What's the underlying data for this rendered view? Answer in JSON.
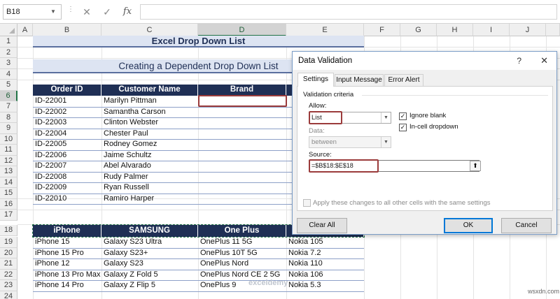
{
  "formula_bar": {
    "name_box": "B18",
    "cancel": "✕",
    "enter": "✓",
    "fx": "fx",
    "value": ""
  },
  "columns": [
    "A",
    "B",
    "C",
    "D",
    "E",
    "F",
    "G",
    "H",
    "I",
    "J"
  ],
  "rows": [
    "1",
    "2",
    "3",
    "4",
    "5",
    "6",
    "7",
    "8",
    "9",
    "10",
    "11",
    "12",
    "13",
    "14",
    "15",
    "16",
    "17",
    "18",
    "19",
    "20",
    "21",
    "22",
    "23",
    "24"
  ],
  "sheet": {
    "title": "Excel Drop Down List",
    "subtitle": "Creating a Dependent Drop Down List",
    "table1": {
      "headers": [
        "Order ID",
        "Customer Name",
        "Brand",
        ""
      ],
      "rows": [
        [
          "ID-22001",
          "Marilyn Pittman"
        ],
        [
          "ID-22002",
          "Samantha Carson"
        ],
        [
          "ID-22003",
          "Clinton Webster"
        ],
        [
          "ID-22004",
          "Chester Paul"
        ],
        [
          "ID-22005",
          "Rodney Gomez"
        ],
        [
          "ID-22006",
          "Jaime Schultz"
        ],
        [
          "ID-22007",
          "Abel Alvarado"
        ],
        [
          "ID-22008",
          "Rudy Palmer"
        ],
        [
          "ID-22009",
          "Ryan Russell"
        ],
        [
          "ID-22010",
          "Ramiro Harper"
        ]
      ]
    },
    "table2": {
      "headers": [
        "iPhone",
        "SAMSUNG",
        "One Plus",
        ""
      ],
      "rows": [
        [
          "iPhone 15",
          "Galaxy S23 Ultra",
          "OnePlus 11 5G",
          "Nokia 105"
        ],
        [
          "iPhone 15 Pro",
          "Galaxy S23+",
          "OnePlus 10T 5G",
          "Nokia 7.2"
        ],
        [
          "iPhone 12",
          "Galaxy S23",
          "OnePlus Nord",
          "Nokia 110"
        ],
        [
          "iPhone 13 Pro Max",
          "Galaxy Z Fold 5",
          "OnePlus Nord CE 2 5G",
          "Nokia 106"
        ],
        [
          "iPhone 14 Pro",
          "Galaxy Z Flip 5",
          "OnePlus 9",
          "Nokia 5.3"
        ]
      ]
    }
  },
  "dialog": {
    "title": "Data Validation",
    "help": "?",
    "close": "✕",
    "tabs": [
      "Settings",
      "Input Message",
      "Error Alert"
    ],
    "group_label": "Validation criteria",
    "allow_label": "Allow:",
    "allow_value": "List",
    "data_label": "Data:",
    "data_value": "between",
    "ignore_blank": "Ignore blank",
    "incell_dropdown": "In-cell dropdown",
    "source_label": "Source:",
    "source_value": "=$B$18:$E$18",
    "apply_all": "Apply these changes to all other cells with the same settings",
    "clear_all": "Clear All",
    "ok": "OK",
    "cancel": "Cancel"
  },
  "watermark": "exceldemy",
  "site_mark": "wsxdn.com"
}
